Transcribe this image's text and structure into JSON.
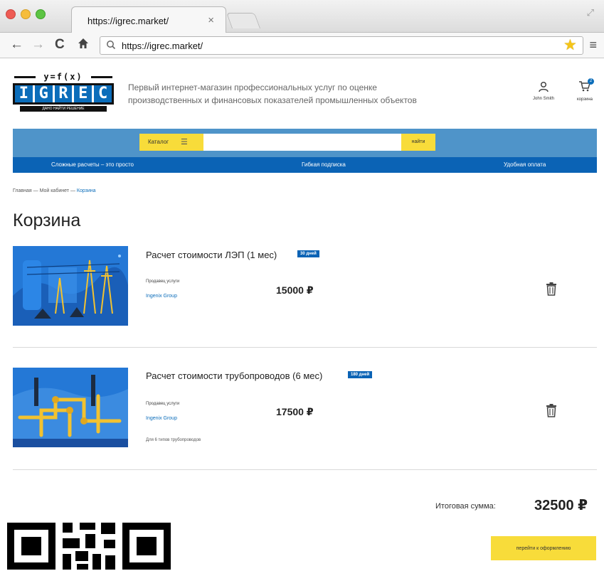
{
  "browser": {
    "tab_title": "https://igrec.market/",
    "tab_close": "×",
    "url": "https://igrec.market/"
  },
  "header": {
    "logo": {
      "formula": "y=f(x)",
      "letters": [
        "I",
        "G",
        "R",
        "E",
        "C"
      ],
      "tagline": "ДАНО НАЙТИ РЕШЕНИЕ"
    },
    "description_line1": "Первый интернет-магазин профессиональных услуг по оценке",
    "description_line2": "производственных и финансовых показателей промышленных объектов",
    "user_name": "John Smith",
    "cart_label": "корзина",
    "cart_count": "2"
  },
  "search": {
    "catalog_label": "Каталог",
    "placeholder": "",
    "button_label": "найти"
  },
  "nav": {
    "items": [
      "Сложные расчеты – это просто",
      "Гибкая подписка",
      "Удобная оплата"
    ]
  },
  "breadcrumb": {
    "home": "Главная",
    "separator": "—",
    "cabinet": "Мой кабинет",
    "current": "Корзина"
  },
  "page_title": "Корзина",
  "cart": {
    "seller_label": "Продавец услуги",
    "items": [
      {
        "name": "Расчет стоимости ЛЭП (1 мес)",
        "badge": "30 дней",
        "seller": "Ingenix Group",
        "price": "15000 ₽",
        "note": ""
      },
      {
        "name": "Расчет стоимости трубопроводов (6 мес)",
        "badge": "180 дней",
        "seller": "Ingenix Group",
        "price": "17500 ₽",
        "note": "Для 6 типов трубопроводов"
      }
    ],
    "total_label": "Итоговая сумма:",
    "total_value": "32500 ₽",
    "checkout_label": "перейти к оформлению"
  },
  "colors": {
    "brand_blue": "#0b6dba",
    "search_band": "#4f94c9",
    "accent_yellow": "#f8dc3a"
  }
}
